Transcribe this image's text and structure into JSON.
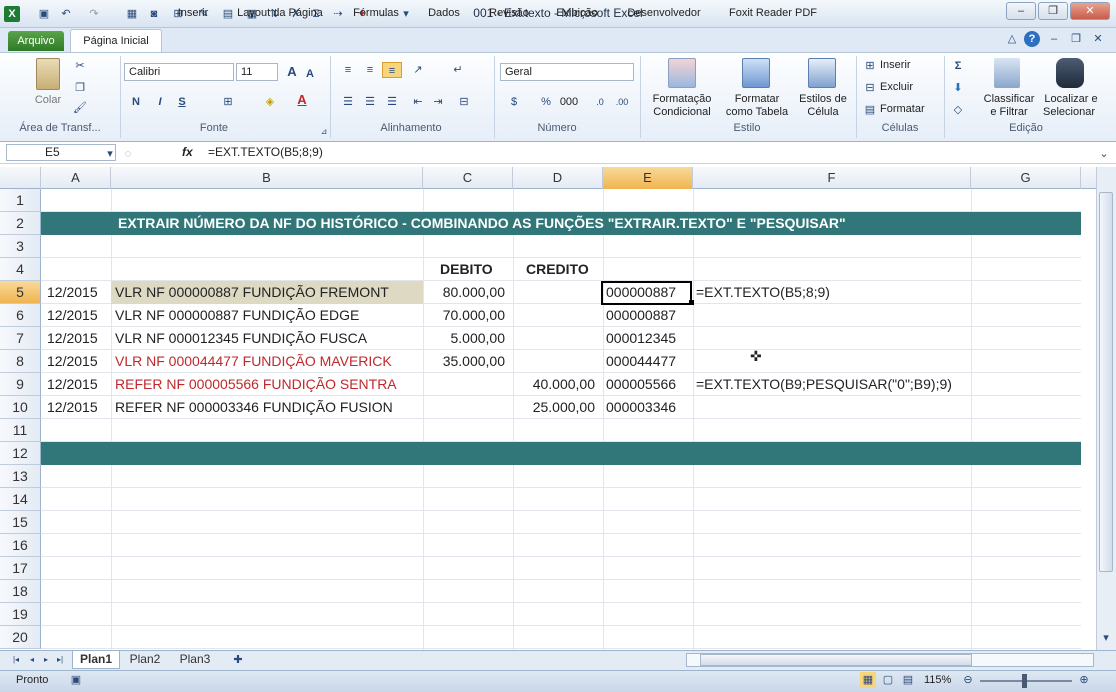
{
  "window": {
    "title": "001 - Ext.texto  -  Microsoft Excel",
    "controls": [
      "–",
      "❐",
      "✕"
    ]
  },
  "ribbon_tabs": [
    "Arquivo",
    "Página Inicial",
    "Inserir",
    "Layout da Página",
    "Fórmulas",
    "Dados",
    "Revisão",
    "Exibição",
    "Desenvolvedor",
    "Foxit Reader PDF"
  ],
  "ribbon": {
    "clipboard": {
      "paste": "Colar",
      "group": "Área de Transf..."
    },
    "font": {
      "name": "Calibri",
      "size": "11",
      "bold": "N",
      "italic": "I",
      "underline": "S",
      "group": "Fonte"
    },
    "alignment": {
      "group": "Alinhamento"
    },
    "number": {
      "format": "Geral",
      "percent": "%",
      "thousands": "000",
      "group": "Número"
    },
    "styles": {
      "cond1": "Formatação",
      "cond2": "Condicional",
      "table1": "Formatar",
      "table2": "como Tabela",
      "cell1": "Estilos de",
      "cell2": "Célula",
      "group": "Estilo"
    },
    "cells": {
      "insert": "Inserir",
      "delete": "Excluir",
      "format": "Formatar",
      "group": "Células"
    },
    "editing": {
      "sort1": "Classificar",
      "sort2": "e Filtrar",
      "find1": "Localizar e",
      "find2": "Selecionar",
      "group": "Edição"
    }
  },
  "formula_bar": {
    "name_box": "E5",
    "fx": "fx",
    "formula": "=EXT.TEXTO(B5;8;9)"
  },
  "columns": [
    "A",
    "B",
    "C",
    "D",
    "E",
    "F",
    "G"
  ],
  "rows": [
    "1",
    "2",
    "3",
    "4",
    "5",
    "6",
    "7",
    "8",
    "9",
    "10",
    "11",
    "12",
    "13",
    "14",
    "15",
    "16",
    "17",
    "18",
    "19",
    "20"
  ],
  "sheet": {
    "title": "EXTRAIR NÚMERO DA NF DO HISTÓRICO -  COMBINANDO AS FUNÇÕES \"EXTRAIR.TEXTO\" E \"PESQUISAR\"",
    "header_debito": "DEBITO",
    "header_credito": "CREDITO",
    "data": [
      {
        "a": "12/2015",
        "b": "VLR NF 000000887 FUNDIÇÃO FREMONT",
        "c": "80.000,00",
        "d": "",
        "e": "000000887",
        "f": "=EXT.TEXTO(B5;8;9)",
        "red": false
      },
      {
        "a": "12/2015",
        "b": "VLR NF 000000887 FUNDIÇÃO EDGE",
        "c": "70.000,00",
        "d": "",
        "e": "000000887",
        "f": "",
        "red": false
      },
      {
        "a": "12/2015",
        "b": "VLR NF 000012345 FUNDIÇÃO FUSCA",
        "c": "5.000,00",
        "d": "",
        "e": "000012345",
        "f": "",
        "red": false
      },
      {
        "a": "12/2015",
        "b": "VLR NF 000044477 FUNDIÇÃO MAVERICK",
        "c": "35.000,00",
        "d": "",
        "e": "000044477",
        "f": "",
        "red": true
      },
      {
        "a": "12/2015",
        "b": "REFER NF 000005566 FUNDIÇÃO SENTRA",
        "c": "",
        "d": "40.000,00",
        "e": "000005566",
        "f": "=EXT.TEXTO(B9;PESQUISAR(\"0\";B9);9)",
        "red": true
      },
      {
        "a": "12/2015",
        "b": "REFER NF 000003346 FUNDIÇÃO FUSION",
        "c": "",
        "d": "25.000,00",
        "e": "000003346",
        "f": "",
        "red": false
      }
    ]
  },
  "sheet_tabs": [
    "Plan1",
    "Plan2",
    "Plan3"
  ],
  "status": {
    "ready": "Pronto",
    "zoom": "115%"
  }
}
